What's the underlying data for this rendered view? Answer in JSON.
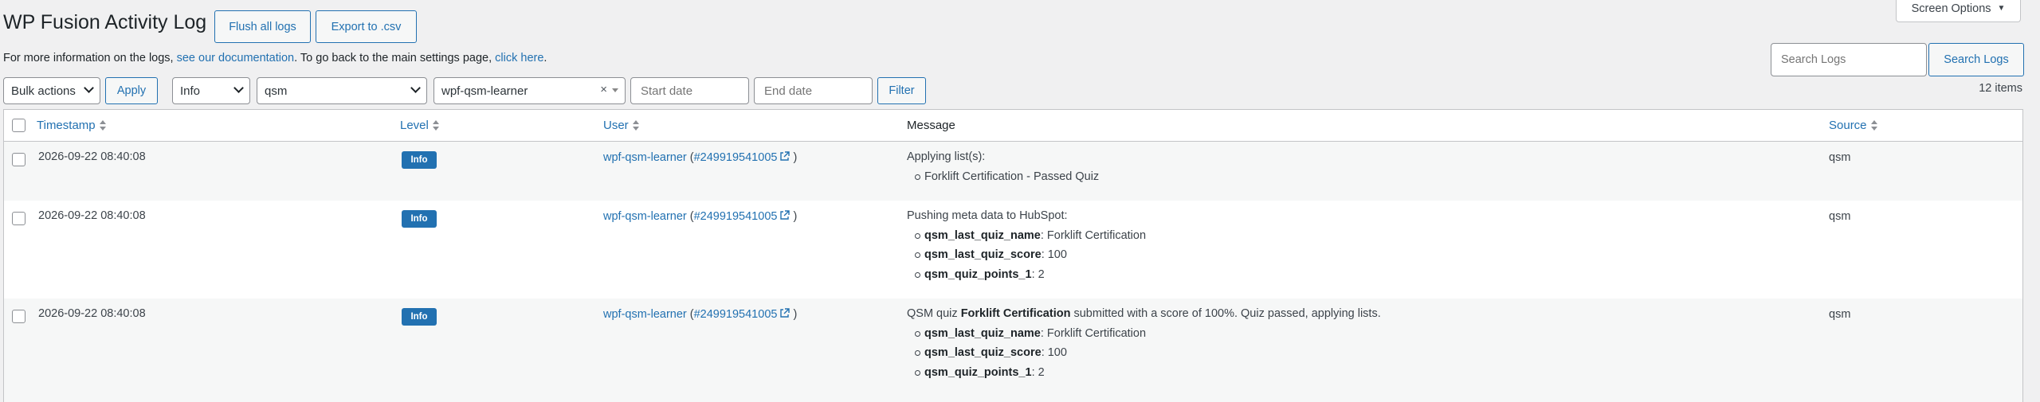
{
  "page": {
    "title": "WP Fusion Activity Log",
    "flush_label": "Flush all logs",
    "export_label": "Export to .csv",
    "screen_options": "Screen Options"
  },
  "info": {
    "prefix": "For more information on the logs, ",
    "doc_link": "see our documentation",
    "middle": ". To go back to the main settings page, ",
    "settings_link": "click here",
    "suffix": "."
  },
  "search": {
    "placeholder": "Search Logs",
    "button": "Search Logs"
  },
  "filters": {
    "bulk_actions": "Bulk actions",
    "apply": "Apply",
    "level": "Info",
    "source": "qsm",
    "user": "wpf-qsm-learner",
    "clear": "×",
    "start_placeholder": "Start date",
    "end_placeholder": "End date",
    "filter": "Filter",
    "items_count": "12 items"
  },
  "table": {
    "columns": {
      "timestamp": "Timestamp",
      "level": "Level",
      "user": "User",
      "message": "Message",
      "source": "Source"
    },
    "rows": [
      {
        "timestamp": "2026-09-22 08:40:08",
        "level": "Info",
        "user_name": "wpf-qsm-learner",
        "user_open": " (",
        "user_id": "#249919541005",
        "user_close": " )",
        "message_intro": "Applying list(s):",
        "message_items": [
          "Forklift Certification - Passed Quiz"
        ],
        "source": "qsm"
      },
      {
        "timestamp": "2026-09-22 08:40:08",
        "level": "Info",
        "user_name": "wpf-qsm-learner",
        "user_open": " (",
        "user_id": "#249919541005",
        "user_close": " )",
        "message_intro": "Pushing meta data to HubSpot:",
        "meta": [
          {
            "key": "qsm_last_quiz_name",
            "value": ": Forklift Certification"
          },
          {
            "key": "qsm_last_quiz_score",
            "value": ": 100"
          },
          {
            "key": "qsm_quiz_points_1",
            "value": ": 2"
          }
        ],
        "source": "qsm"
      },
      {
        "timestamp": "2026-09-22 08:40:08",
        "level": "Info",
        "user_name": "wpf-qsm-learner",
        "user_open": " (",
        "user_id": "#249919541005",
        "user_close": " )",
        "message_pre": "QSM quiz ",
        "message_quiz": "Forklift Certification",
        "message_post": " submitted with a score of 100%. Quiz passed, applying lists.",
        "meta": [
          {
            "key": "qsm_last_quiz_name",
            "value": ": Forklift Certification"
          },
          {
            "key": "qsm_last_quiz_score",
            "value": ": 100"
          },
          {
            "key": "qsm_quiz_points_1",
            "value": ": 2"
          }
        ],
        "source": "qsm"
      }
    ]
  },
  "colors": {
    "accent": "#2271b1",
    "background": "#f0f0f1",
    "row_alt": "#f6f7f7"
  }
}
